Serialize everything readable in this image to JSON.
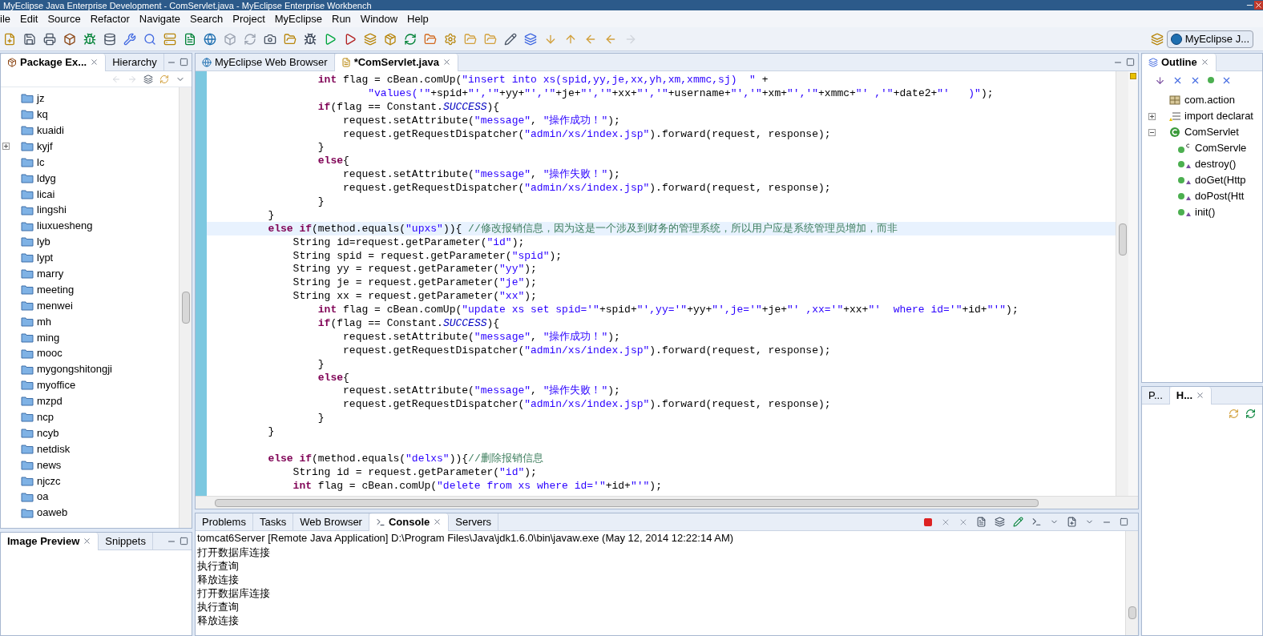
{
  "window": {
    "title": "MyEclipse Java Enterprise Development - ComServlet.java - MyEclipse Enterprise Workbench"
  },
  "menu": [
    "ile",
    "Edit",
    "Source",
    "Refactor",
    "Navigate",
    "Search",
    "Project",
    "MyEclipse",
    "Run",
    "Window",
    "Help"
  ],
  "perspective": {
    "label": "MyEclipse J..."
  },
  "package_explorer": {
    "tabs": [
      {
        "label": "Package Ex...",
        "selected": true
      },
      {
        "label": "Hierarchy",
        "selected": false
      }
    ],
    "items": [
      {
        "label": "jz",
        "expandable": false
      },
      {
        "label": "kq",
        "expandable": false
      },
      {
        "label": "kuaidi",
        "expandable": false
      },
      {
        "label": "kyjf",
        "expandable": true
      },
      {
        "label": "lc",
        "expandable": false
      },
      {
        "label": "ldyg",
        "expandable": false
      },
      {
        "label": "licai",
        "expandable": false
      },
      {
        "label": "lingshi",
        "expandable": false
      },
      {
        "label": "liuxuesheng",
        "expandable": false
      },
      {
        "label": "lyb",
        "expandable": false
      },
      {
        "label": "lypt",
        "expandable": false
      },
      {
        "label": "marry",
        "expandable": false
      },
      {
        "label": "meeting",
        "expandable": false
      },
      {
        "label": "menwei",
        "expandable": false
      },
      {
        "label": "mh",
        "expandable": false
      },
      {
        "label": "ming",
        "expandable": false
      },
      {
        "label": "mooc",
        "expandable": false
      },
      {
        "label": "mygongshitongji",
        "expandable": false
      },
      {
        "label": "myoffice",
        "expandable": false
      },
      {
        "label": "mzpd",
        "expandable": false
      },
      {
        "label": "ncp",
        "expandable": false
      },
      {
        "label": "ncyb",
        "expandable": false
      },
      {
        "label": "netdisk",
        "expandable": false
      },
      {
        "label": "news",
        "expandable": false
      },
      {
        "label": "njczc",
        "expandable": false
      },
      {
        "label": "oa",
        "expandable": false
      },
      {
        "label": "oaweb",
        "expandable": false
      }
    ]
  },
  "preview_panel": {
    "tabs": [
      {
        "label": "Image Preview",
        "selected": true
      },
      {
        "label": "Snippets",
        "selected": false
      }
    ]
  },
  "editor": {
    "tabs": [
      {
        "label": "MyEclipse Web Browser",
        "selected": false
      },
      {
        "label": "*ComServlet.java",
        "selected": true
      }
    ],
    "lines": [
      {
        "current": false,
        "segments": [
          {
            "kind": "keyword",
            "text": "                int"
          },
          {
            "kind": "plain",
            "text": " flag = cBean.comUp("
          },
          {
            "kind": "string",
            "text": "\"insert into xs(spid,yy,je,xx,yh,xm,xmmc,sj)  \""
          },
          {
            "kind": "plain",
            "text": " +"
          }
        ]
      },
      {
        "current": false,
        "segments": [
          {
            "kind": "string",
            "text": "                        \"values('\""
          },
          {
            "kind": "plain",
            "text": "+spid+"
          },
          {
            "kind": "string",
            "text": "\"','\""
          },
          {
            "kind": "plain",
            "text": "+yy+"
          },
          {
            "kind": "string",
            "text": "\"','\""
          },
          {
            "kind": "plain",
            "text": "+je+"
          },
          {
            "kind": "string",
            "text": "\"','\""
          },
          {
            "kind": "plain",
            "text": "+xx+"
          },
          {
            "kind": "string",
            "text": "\"','\""
          },
          {
            "kind": "plain",
            "text": "+username+"
          },
          {
            "kind": "string",
            "text": "\"','\""
          },
          {
            "kind": "plain",
            "text": "+xm+"
          },
          {
            "kind": "string",
            "text": "\"','\""
          },
          {
            "kind": "plain",
            "text": "+xmmc+"
          },
          {
            "kind": "string",
            "text": "\"' ,'\""
          },
          {
            "kind": "plain",
            "text": "+date2+"
          },
          {
            "kind": "string",
            "text": "\"'   )\""
          },
          {
            "kind": "plain",
            "text": ");"
          }
        ]
      },
      {
        "current": false,
        "segments": [
          {
            "kind": "keyword",
            "text": "                if"
          },
          {
            "kind": "plain",
            "text": "(flag == Constant."
          },
          {
            "kind": "constant",
            "text": "SUCCESS"
          },
          {
            "kind": "plain",
            "text": "){"
          }
        ]
      },
      {
        "current": false,
        "segments": [
          {
            "kind": "plain",
            "text": "                    request.setAttribute("
          },
          {
            "kind": "string",
            "text": "\"message\""
          },
          {
            "kind": "plain",
            "text": ", "
          },
          {
            "kind": "string",
            "text": "\"操作成功！\""
          },
          {
            "kind": "plain",
            "text": ");"
          }
        ]
      },
      {
        "current": false,
        "segments": [
          {
            "kind": "plain",
            "text": "                    request.getRequestDispatcher("
          },
          {
            "kind": "string",
            "text": "\"admin/xs/index.jsp\""
          },
          {
            "kind": "plain",
            "text": ").forward(request, response);"
          }
        ]
      },
      {
        "current": false,
        "segments": [
          {
            "kind": "plain",
            "text": "                }"
          }
        ]
      },
      {
        "current": false,
        "segments": [
          {
            "kind": "keyword",
            "text": "                else"
          },
          {
            "kind": "plain",
            "text": "{"
          }
        ]
      },
      {
        "current": false,
        "segments": [
          {
            "kind": "plain",
            "text": "                    request.setAttribute("
          },
          {
            "kind": "string",
            "text": "\"message\""
          },
          {
            "kind": "plain",
            "text": ", "
          },
          {
            "kind": "string",
            "text": "\"操作失败！\""
          },
          {
            "kind": "plain",
            "text": ");"
          }
        ]
      },
      {
        "current": false,
        "segments": [
          {
            "kind": "plain",
            "text": "                    request.getRequestDispatcher("
          },
          {
            "kind": "string",
            "text": "\"admin/xs/index.jsp\""
          },
          {
            "kind": "plain",
            "text": ").forward(request, response);"
          }
        ]
      },
      {
        "current": false,
        "segments": [
          {
            "kind": "plain",
            "text": "                }"
          }
        ]
      },
      {
        "current": false,
        "segments": [
          {
            "kind": "plain",
            "text": "        }"
          }
        ]
      },
      {
        "current": true,
        "segments": [
          {
            "kind": "keyword",
            "text": "        else if"
          },
          {
            "kind": "plain",
            "text": "(method.equals("
          },
          {
            "kind": "string",
            "text": "\"upxs\""
          },
          {
            "kind": "plain",
            "text": ")){ "
          },
          {
            "kind": "comment",
            "text": "//修改报销信息，因为这是一个涉及到财务的管理系统，所以用户应是系统管理员增加，而非"
          }
        ]
      },
      {
        "current": false,
        "segments": [
          {
            "kind": "plain",
            "text": "            String id=request.getParameter("
          },
          {
            "kind": "string",
            "text": "\"id\""
          },
          {
            "kind": "plain",
            "text": ");"
          }
        ]
      },
      {
        "current": false,
        "segments": [
          {
            "kind": "plain",
            "text": "            String spid = request.getParameter("
          },
          {
            "kind": "string",
            "text": "\"spid\""
          },
          {
            "kind": "plain",
            "text": ");"
          }
        ]
      },
      {
        "current": false,
        "segments": [
          {
            "kind": "plain",
            "text": "            String yy = request.getParameter("
          },
          {
            "kind": "string",
            "text": "\"yy\""
          },
          {
            "kind": "plain",
            "text": ");"
          }
        ]
      },
      {
        "current": false,
        "segments": [
          {
            "kind": "plain",
            "text": "            String je = request.getParameter("
          },
          {
            "kind": "string",
            "text": "\"je\""
          },
          {
            "kind": "plain",
            "text": ");"
          }
        ]
      },
      {
        "current": false,
        "segments": [
          {
            "kind": "plain",
            "text": "            String xx = request.getParameter("
          },
          {
            "kind": "string",
            "text": "\"xx\""
          },
          {
            "kind": "plain",
            "text": ");"
          }
        ]
      },
      {
        "current": false,
        "segments": [
          {
            "kind": "keyword",
            "text": "                int"
          },
          {
            "kind": "plain",
            "text": " flag = cBean.comUp("
          },
          {
            "kind": "string",
            "text": "\"update xs set spid='\""
          },
          {
            "kind": "plain",
            "text": "+spid+"
          },
          {
            "kind": "string",
            "text": "\"',yy='\""
          },
          {
            "kind": "plain",
            "text": "+yy+"
          },
          {
            "kind": "string",
            "text": "\"',je='\""
          },
          {
            "kind": "plain",
            "text": "+je+"
          },
          {
            "kind": "string",
            "text": "\"' ,xx='\""
          },
          {
            "kind": "plain",
            "text": "+xx+"
          },
          {
            "kind": "string",
            "text": "\"'  where id='\""
          },
          {
            "kind": "plain",
            "text": "+id+"
          },
          {
            "kind": "string",
            "text": "\"'\""
          },
          {
            "kind": "plain",
            "text": ");"
          }
        ]
      },
      {
        "current": false,
        "segments": [
          {
            "kind": "keyword",
            "text": "                if"
          },
          {
            "kind": "plain",
            "text": "(flag == Constant."
          },
          {
            "kind": "constant",
            "text": "SUCCESS"
          },
          {
            "kind": "plain",
            "text": "){"
          }
        ]
      },
      {
        "current": false,
        "segments": [
          {
            "kind": "plain",
            "text": "                    request.setAttribute("
          },
          {
            "kind": "string",
            "text": "\"message\""
          },
          {
            "kind": "plain",
            "text": ", "
          },
          {
            "kind": "string",
            "text": "\"操作成功！\""
          },
          {
            "kind": "plain",
            "text": ");"
          }
        ]
      },
      {
        "current": false,
        "segments": [
          {
            "kind": "plain",
            "text": "                    request.getRequestDispatcher("
          },
          {
            "kind": "string",
            "text": "\"admin/xs/index.jsp\""
          },
          {
            "kind": "plain",
            "text": ").forward(request, response);"
          }
        ]
      },
      {
        "current": false,
        "segments": [
          {
            "kind": "plain",
            "text": "                }"
          }
        ]
      },
      {
        "current": false,
        "segments": [
          {
            "kind": "keyword",
            "text": "                else"
          },
          {
            "kind": "plain",
            "text": "{"
          }
        ]
      },
      {
        "current": false,
        "segments": [
          {
            "kind": "plain",
            "text": "                    request.setAttribute("
          },
          {
            "kind": "string",
            "text": "\"message\""
          },
          {
            "kind": "plain",
            "text": ", "
          },
          {
            "kind": "string",
            "text": "\"操作失败！\""
          },
          {
            "kind": "plain",
            "text": ");"
          }
        ]
      },
      {
        "current": false,
        "segments": [
          {
            "kind": "plain",
            "text": "                    request.getRequestDispatcher("
          },
          {
            "kind": "string",
            "text": "\"admin/xs/index.jsp\""
          },
          {
            "kind": "plain",
            "text": ").forward(request, response);"
          }
        ]
      },
      {
        "current": false,
        "segments": [
          {
            "kind": "plain",
            "text": "                }"
          }
        ]
      },
      {
        "current": false,
        "segments": [
          {
            "kind": "plain",
            "text": "        }"
          }
        ]
      },
      {
        "current": false
      },
      {
        "current": false,
        "segments": [
          {
            "kind": "keyword",
            "text": "        else if"
          },
          {
            "kind": "plain",
            "text": "(method.equals("
          },
          {
            "kind": "string",
            "text": "\"delxs\""
          },
          {
            "kind": "plain",
            "text": ")){"
          },
          {
            "kind": "comment",
            "text": "//删除报销信息"
          }
        ]
      },
      {
        "current": false,
        "segments": [
          {
            "kind": "plain",
            "text": "            String id = request.getParameter("
          },
          {
            "kind": "string",
            "text": "\"id\""
          },
          {
            "kind": "plain",
            "text": ");"
          }
        ]
      },
      {
        "current": false,
        "segments": [
          {
            "kind": "keyword",
            "text": "            int"
          },
          {
            "kind": "plain",
            "text": " flag = cBean.comUp("
          },
          {
            "kind": "string",
            "text": "\"delete from xs where id='\""
          },
          {
            "kind": "plain",
            "text": "+id+"
          },
          {
            "kind": "string",
            "text": "\"'\""
          },
          {
            "kind": "plain",
            "text": ");"
          }
        ]
      }
    ]
  },
  "outline": {
    "title": "Outline",
    "items": [
      {
        "label": "com.action",
        "kind": "package"
      },
      {
        "label": "import declarat",
        "kind": "imports",
        "expanded": false
      },
      {
        "label": "ComServlet",
        "kind": "class",
        "expanded": true,
        "children": [
          {
            "label": "ComServle",
            "kind": "constructor"
          },
          {
            "label": "destroy()",
            "kind": "method"
          },
          {
            "label": "doGet(Http",
            "kind": "method"
          },
          {
            "label": "doPost(Htt",
            "kind": "method"
          },
          {
            "label": "init()",
            "kind": "method"
          }
        ]
      }
    ]
  },
  "side_panel": {
    "tabs": [
      {
        "label": "P...",
        "selected": false
      },
      {
        "label": "H...",
        "selected": true
      }
    ]
  },
  "console_panel": {
    "tabs": [
      {
        "label": "Problems",
        "selected": false
      },
      {
        "label": "Tasks",
        "selected": false
      },
      {
        "label": "Web Browser",
        "selected": false
      },
      {
        "label": "Console",
        "selected": true
      },
      {
        "label": "Servers",
        "selected": false
      }
    ],
    "header": "tomcat6Server [Remote Java Application] D:\\Program Files\\Java\\jdk1.6.0\\bin\\javaw.exe (May 12, 2014 12:22:14 AM)",
    "lines": [
      "打开数据库连接",
      "执行查询",
      "释放连接",
      "打开数据库连接",
      "执行查询",
      "释放连接"
    ]
  }
}
